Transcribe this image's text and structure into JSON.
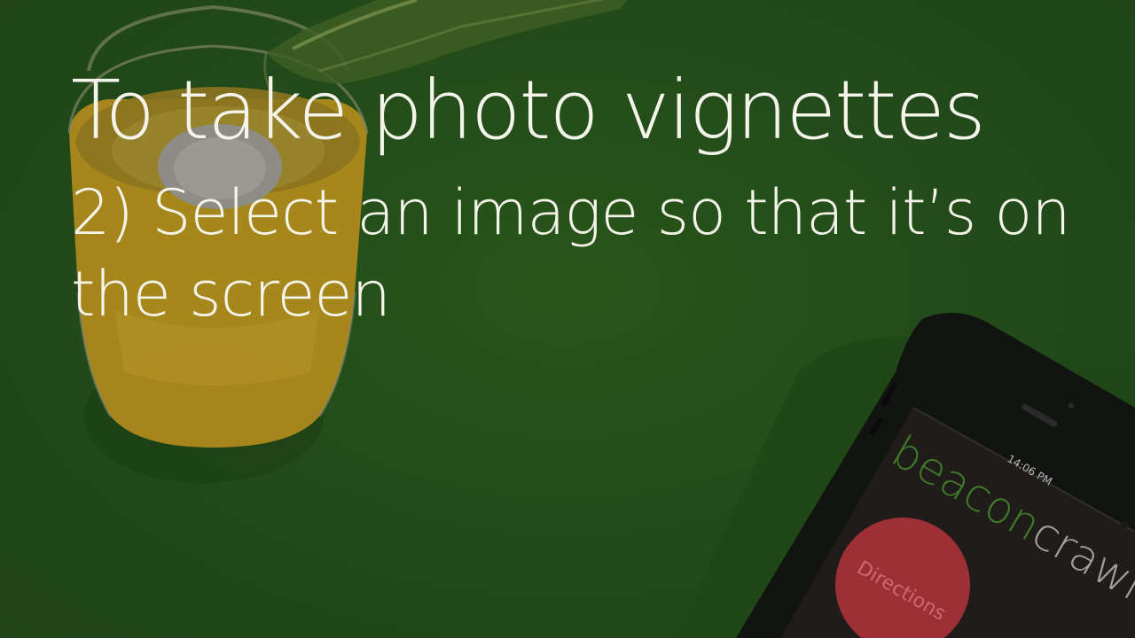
{
  "card": {
    "title": "To take photo vignettes",
    "step": "2) Select an image so that it’s on the screen"
  },
  "phone": {
    "time": "14:06 PM",
    "brand_part1": "beacon",
    "brand_part2": "crawl",
    "button_label": "Directions"
  },
  "colors": {
    "background": "#244f14",
    "text": "#f4f4ea",
    "brand_green": "#3f7a2a",
    "button_red": "#9c3036",
    "beer_amber": "#b38b1e"
  }
}
